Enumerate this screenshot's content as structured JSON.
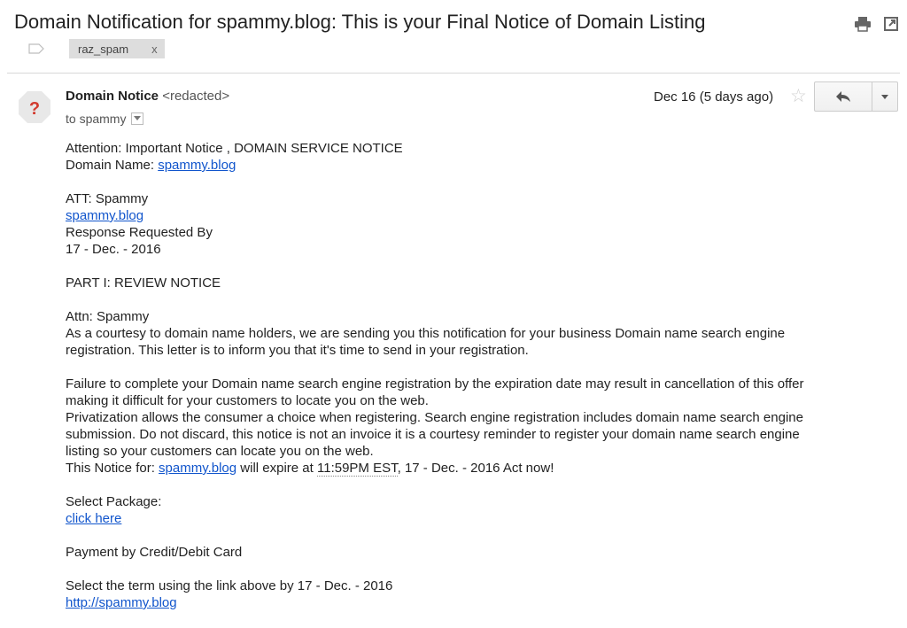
{
  "email": {
    "subject": "Domain Notification for spammy.blog: This is your Final Notice of Domain Listing",
    "label": "raz_spam",
    "label_remove": "x",
    "sender_name": "Domain Notice",
    "sender_email": "<redacted>",
    "to": "to spammy",
    "date": "Dec 16 (5 days ago)",
    "star_glyph": "☆"
  },
  "body": {
    "p1_l1": "Attention: Important Notice , DOMAIN SERVICE NOTICE",
    "p1_l2_prefix": "Domain Name: ",
    "p1_l2_link": "spammy.blog",
    "att": "ATT: Spammy",
    "att_link": "spammy.blog",
    "response": "Response Requested By",
    "response_date": "17 - Dec. - 2016",
    "part1": "PART I: REVIEW NOTICE",
    "attn": "Attn: Spammy",
    "courtesy_l1": "As a courtesy to domain name holders, we are sending you this notification for your business Domain name search engine",
    "courtesy_l2": "registration. This letter is to inform you that it's time to send in your registration.",
    "fail_l1": "Failure to complete your Domain name search engine registration by the expiration date may result in cancellation of this offer",
    "fail_l2": "making it difficult for your customers to locate you on the web.",
    "priv_l1": "Privatization allows the consumer a choice when registering. Search engine registration includes domain name search engine",
    "priv_l2": "submission. Do not discard, this notice is not an invoice it is a courtesy reminder to register your domain name search engine",
    "priv_l3": "listing so your customers can locate you on the web.",
    "notice_prefix": "This Notice for: ",
    "notice_link": "spammy.blog",
    "notice_mid": " will expire at ",
    "notice_time": "11:59PM EST",
    "notice_suffix": ", 17 - Dec. - 2016 Act now!",
    "select_pkg": "Select Package:",
    "click_here": "click here",
    "payment": "Payment by Credit/Debit Card",
    "select_term": "Select the term using the link above by 17 - Dec. - 2016",
    "final_link": "http://spammy.blog"
  },
  "icons": {
    "print": "print-icon",
    "popout": "new-window-icon",
    "label_tag": "label-icon",
    "avatar": "unknown-sender-icon",
    "reply": "reply-icon",
    "more": "chevron-down-icon"
  }
}
